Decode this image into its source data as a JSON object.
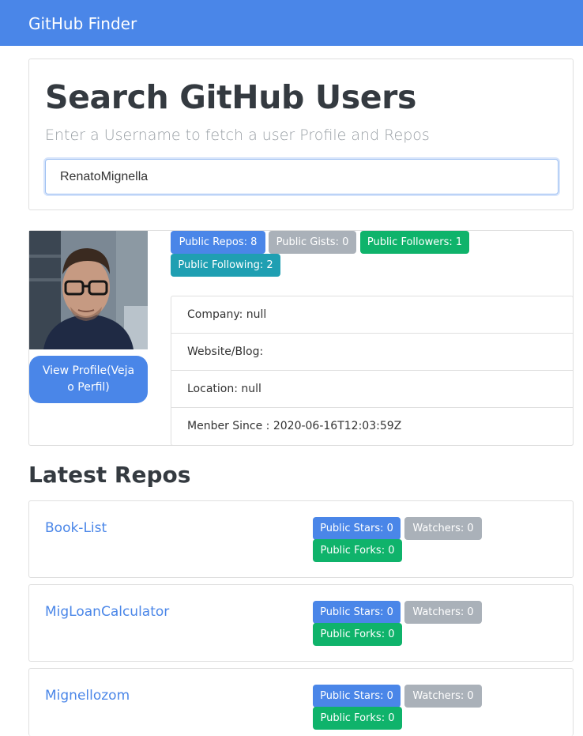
{
  "navbar": {
    "brand": "GitHub Finder"
  },
  "search": {
    "title": "Search GitHub Users",
    "subtitle": "Enter a Username to fetch a user Profile and Repos",
    "value": "RenatoMignella"
  },
  "profile": {
    "view_profile_label": "View Profile(Veja o Perfil)",
    "badges": {
      "public_repos": "Public Repos: 8",
      "public_gists": "Public Gists: 0",
      "public_followers": "Public Followers: 1",
      "public_following": "Public Following: 2"
    },
    "info": {
      "company": "Company: null",
      "website": "Website/Blog:",
      "location": "Location: null",
      "member_since": "Menber Since : 2020-06-16T12:03:59Z"
    }
  },
  "repos": {
    "title": "Latest Repos",
    "items": [
      {
        "name": "Book-List",
        "stars": "Public Stars: 0",
        "watchers": "Watchers: 0",
        "forks": "Public Forks: 0"
      },
      {
        "name": "MigLoanCalculator",
        "stars": "Public Stars: 0",
        "watchers": "Watchers: 0",
        "forks": "Public Forks: 0"
      },
      {
        "name": "Mignellozom",
        "stars": "Public Stars: 0",
        "watchers": "Watchers: 0",
        "forks": "Public Forks: 0"
      }
    ]
  },
  "colors": {
    "primary": "#4a86e8",
    "secondary": "#aab1b9",
    "success": "#0fb36b",
    "info": "#1f9fb2"
  }
}
